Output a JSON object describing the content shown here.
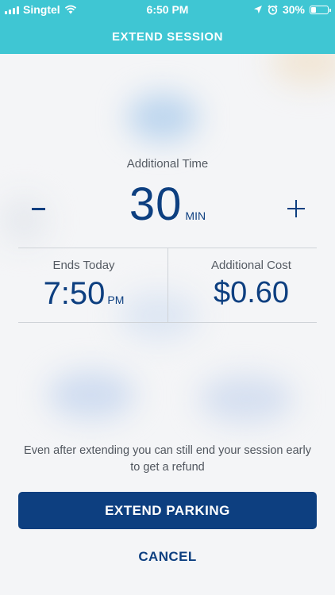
{
  "status_bar": {
    "carrier": "Singtel",
    "time": "6:50 PM",
    "battery": "30%",
    "battery_level": 0.3
  },
  "header": {
    "title": "EXTEND SESSION"
  },
  "additional_time": {
    "label": "Additional Time",
    "value": "30",
    "unit": "MIN",
    "decrease_symbol": "−",
    "increase_symbol": "+"
  },
  "ends": {
    "label": "Ends Today",
    "time": "7:50",
    "ampm": "PM"
  },
  "cost": {
    "label": "Additional Cost",
    "value": "$0.60"
  },
  "note": "Even after extending you can still end your session early to get a refund",
  "buttons": {
    "extend": "EXTEND PARKING",
    "cancel": "CANCEL"
  },
  "colors": {
    "header": "#3fc6d3",
    "primary": "#0d3f80"
  }
}
